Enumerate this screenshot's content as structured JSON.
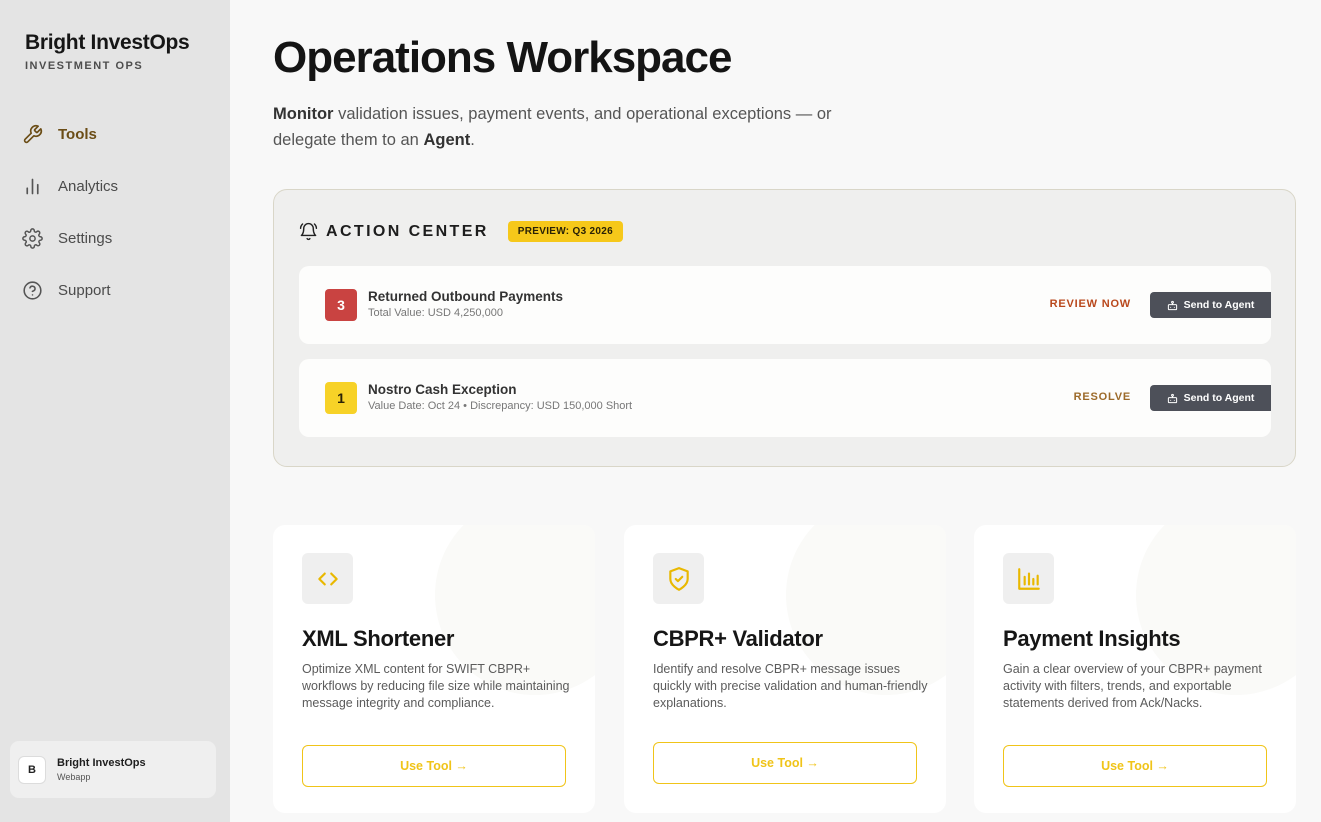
{
  "brand": {
    "name": "Bright InvestOps",
    "subtitle": "INVESTMENT OPS"
  },
  "nav": [
    {
      "label": "Tools",
      "icon": "wrench-icon",
      "active": true
    },
    {
      "label": "Analytics",
      "icon": "bar-chart-icon",
      "active": false
    },
    {
      "label": "Settings",
      "icon": "gear-icon",
      "active": false
    },
    {
      "label": "Support",
      "icon": "help-circle-icon",
      "active": false
    }
  ],
  "account": {
    "initial": "B",
    "name": "Bright InvestOps",
    "type": "Webapp"
  },
  "page": {
    "title": "Operations Workspace",
    "desc_bold1": "Monitor",
    "desc_mid": " validation issues, payment events, and operational exceptions — or delegate them to an ",
    "desc_bold2": "Agent",
    "desc_end": "."
  },
  "action_center": {
    "title": "ACTION CENTER",
    "badge": "PREVIEW: Q3 2026",
    "items": [
      {
        "count": "3",
        "label": "Returned Outbound Payments",
        "meta": "Total Value: USD 4,250,000",
        "action": "REVIEW NOW",
        "send_label": "Send to Agent",
        "color": "#c94341"
      },
      {
        "count": "1",
        "label": "Nostro Cash Exception",
        "meta": "Value Date: Oct 24 • Discrepancy: USD 150,000 Short",
        "action": "RESOLVE",
        "send_label": "Send to Agent",
        "color": "#f7d227"
      }
    ]
  },
  "tools": [
    {
      "icon": "code-icon",
      "title": "XML Shortener",
      "desc": "Optimize XML content for SWIFT CBPR+ workflows by reducing file size while maintaining message integrity and compliance.",
      "button": "Use Tool →"
    },
    {
      "icon": "shield-check-icon",
      "title": "CBPR+ Validator",
      "desc": "Identify and resolve CBPR+ message issues quickly with precise validation and human-friendly explanations.",
      "button": "Use Tool →"
    },
    {
      "icon": "bar-chart-icon",
      "title": "Payment Insights",
      "desc": "Gain a clear overview of your CBPR+ payment activity with filters, trends, and exportable statements derived from Ack/Nacks.",
      "button": "Use Tool →"
    }
  ],
  "colors": {
    "accent": "#f0c419",
    "brand_text": "#6b4d16",
    "danger": "#c94341",
    "agent_button": "#4d5059"
  }
}
